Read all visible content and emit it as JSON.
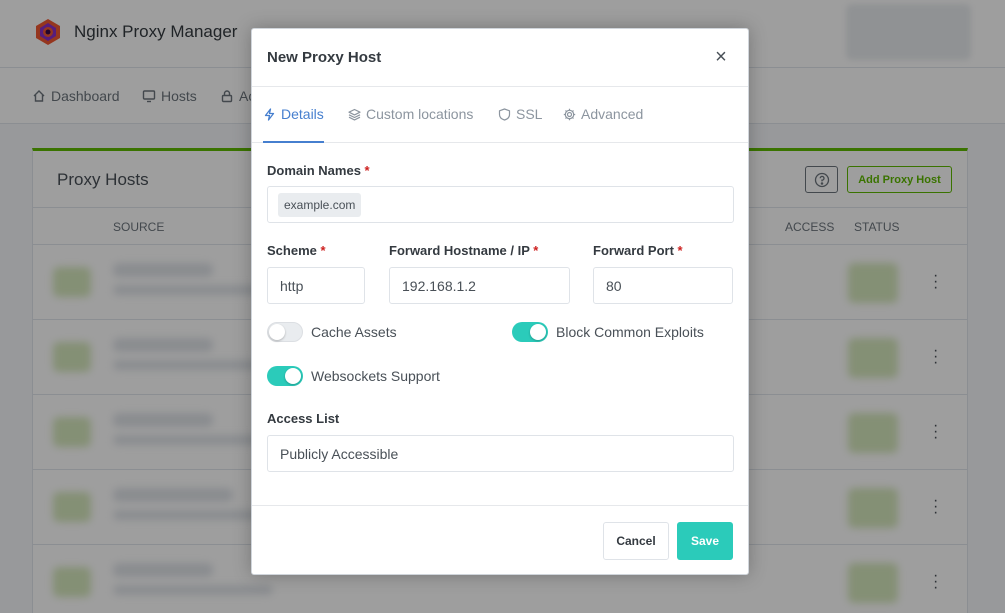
{
  "app": {
    "name": "Nginx Proxy Manager"
  },
  "nav": {
    "items": [
      {
        "label": "Dashboard",
        "icon": "home-icon"
      },
      {
        "label": "Hosts",
        "icon": "monitor-icon"
      },
      {
        "label": "Ac",
        "icon": "lock-icon"
      }
    ]
  },
  "card": {
    "title": "Proxy Hosts",
    "add_button": "Add Proxy Host",
    "columns": {
      "source": "SOURCE",
      "access": "ACCESS",
      "status": "STATUS"
    }
  },
  "modal": {
    "title": "New Proxy Host",
    "close": "×",
    "tabs": [
      {
        "label": "Details",
        "icon": "lightning-icon",
        "active": true
      },
      {
        "label": "Custom locations",
        "icon": "layers-icon",
        "active": false
      },
      {
        "label": "SSL",
        "icon": "shield-icon",
        "active": false
      },
      {
        "label": "Advanced",
        "icon": "gear-icon",
        "active": false
      }
    ],
    "fields": {
      "domain_names": {
        "label": "Domain Names",
        "required": "*",
        "chips": [
          "example.com"
        ]
      },
      "scheme": {
        "label": "Scheme",
        "required": "*",
        "value": "http"
      },
      "forward_host": {
        "label": "Forward Hostname / IP",
        "required": "*",
        "value": "192.168.1.2"
      },
      "forward_port": {
        "label": "Forward Port",
        "required": "*",
        "value": "80"
      },
      "access_list": {
        "label": "Access List",
        "value": "Publicly Accessible"
      }
    },
    "toggles": {
      "cache_assets": {
        "label": "Cache Assets",
        "on": false
      },
      "block_exploits": {
        "label": "Block Common Exploits",
        "on": true
      },
      "websockets": {
        "label": "Websockets Support",
        "on": true
      }
    },
    "buttons": {
      "cancel": "Cancel",
      "save": "Save"
    }
  },
  "colors": {
    "accent": "#467fcf",
    "teal": "#2bcbba",
    "green": "#5eba00",
    "required": "#cd201f"
  }
}
